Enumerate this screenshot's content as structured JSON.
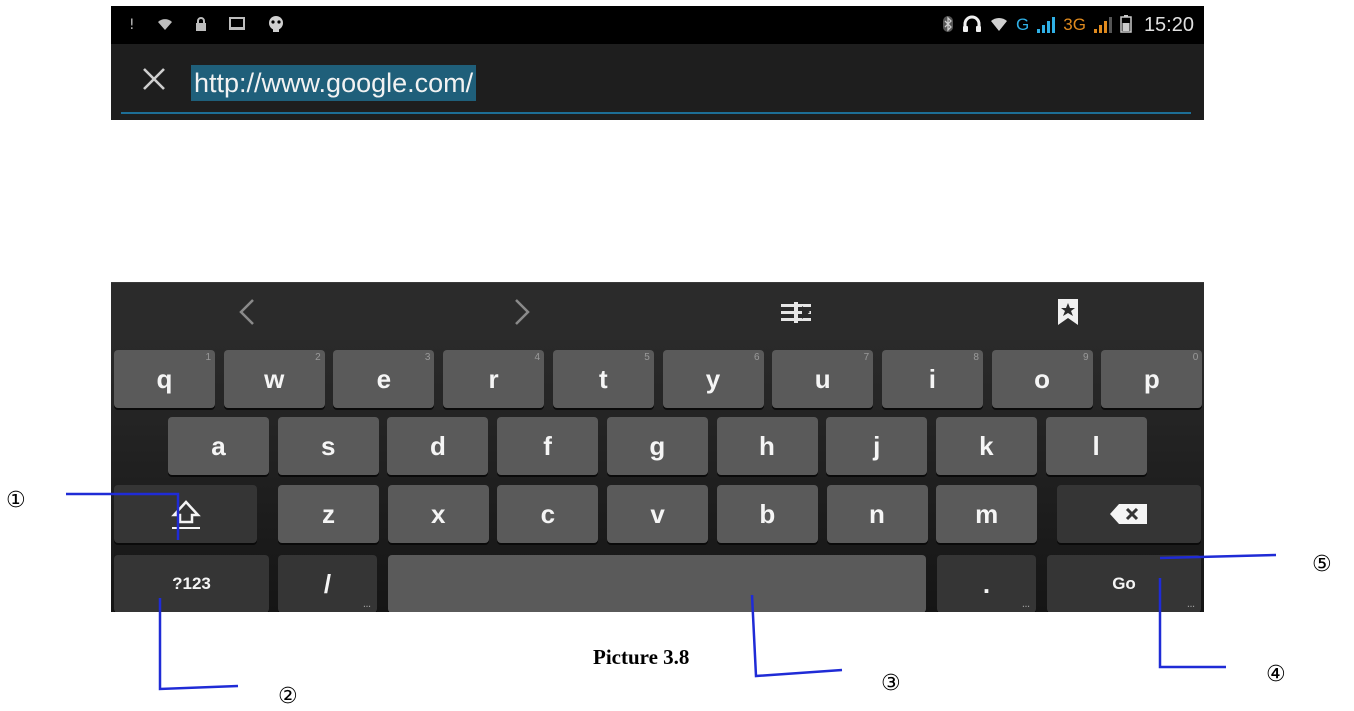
{
  "status_bar": {
    "left_icons": [
      "notification-alert-icon",
      "wifi-icon",
      "lock-icon",
      "usb-debug-icon",
      "android-icon"
    ],
    "right_icons": [
      "bluetooth-icon",
      "headset-icon",
      "wifi-signal-icon",
      "signal-bars-icon",
      "signal-bars-icon",
      "battery-icon"
    ],
    "network_1": "G",
    "network_2": "3G",
    "time": "15:20"
  },
  "url_bar": {
    "close_icon": "close-icon",
    "url": "http://www.google.com/"
  },
  "nav_toolbar": {
    "back_icon": "chevron-left-icon",
    "forward_icon": "chevron-right-icon",
    "tabs_icon": "tabs-icon",
    "bookmark_icon": "bookmark-icon"
  },
  "keyboard": {
    "row1": [
      {
        "label": "q",
        "hint": "1"
      },
      {
        "label": "w",
        "hint": "2"
      },
      {
        "label": "e",
        "hint": "3"
      },
      {
        "label": "r",
        "hint": "4"
      },
      {
        "label": "t",
        "hint": "5"
      },
      {
        "label": "y",
        "hint": "6"
      },
      {
        "label": "u",
        "hint": "7"
      },
      {
        "label": "i",
        "hint": "8"
      },
      {
        "label": "o",
        "hint": "9"
      },
      {
        "label": "p",
        "hint": "0"
      }
    ],
    "row2": [
      "a",
      "s",
      "d",
      "f",
      "g",
      "h",
      "j",
      "k",
      "l"
    ],
    "row3": [
      "z",
      "x",
      "c",
      "v",
      "b",
      "n",
      "m"
    ],
    "shift_icon": "shift-icon",
    "backspace_icon": "backspace-icon",
    "symbols_key": "?123",
    "slash_key": "/",
    "period_key": ".",
    "go_key": "Go"
  },
  "caption": "Picture 3.8",
  "callouts": {
    "c1": "①",
    "c2": "②",
    "c3": "③",
    "c4": "④",
    "c5": "⑤"
  },
  "colors": {
    "callout_line": "#1f2bd6",
    "accent": "#2fb0e6"
  }
}
